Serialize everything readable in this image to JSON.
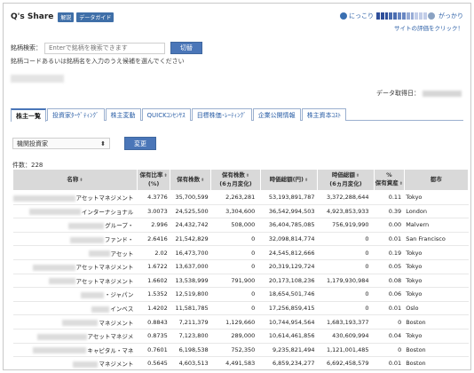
{
  "header": {
    "logo": "Q's Share",
    "badge_explain": "解説",
    "badge_guide": "データガイド"
  },
  "rating": {
    "good_label": "にっこり",
    "bad_label": "がっかり",
    "link": "サイトの評価をクリック！"
  },
  "search": {
    "label": "銘柄検索：",
    "placeholder": "Enterで銘柄を検索できます",
    "button": "切替",
    "hint": "銘柄コードあるいは銘柄名を入力のうえ候補を選んでください"
  },
  "acquisition": {
    "label": "データ取得日："
  },
  "tabs": [
    {
      "label": "株主一覧",
      "active": true
    },
    {
      "label": "投資家ﾀｰｹﾞﾃｨﾝｸﾞ"
    },
    {
      "label": "株主変動"
    },
    {
      "label": "QUICKｺﾝｾﾝｻｽ"
    },
    {
      "label": "目標株価･ﾚｰﾃｨﾝｸﾞ"
    },
    {
      "label": "企業公開情報"
    },
    {
      "label": "株主資本ｺｽﾄ"
    }
  ],
  "filter": {
    "selected": "機関投資家",
    "button": "変更"
  },
  "count": "件数：228",
  "table": {
    "headers": [
      {
        "line1": "名称",
        "line2": ""
      },
      {
        "line1": "保有比率",
        "line2": "(%)"
      },
      {
        "line1": "保有株数",
        "line2": ""
      },
      {
        "line1": "保有株数",
        "line2": "(6ヵ月変化)"
      },
      {
        "line1": "時価総額(円)",
        "line2": ""
      },
      {
        "line1": "時価総額",
        "line2": "(6ヵ月変化)"
      },
      {
        "line1": "%",
        "line2": "保有資産"
      },
      {
        "line1": "都市",
        "line2": ""
      }
    ],
    "rows": [
      {
        "name": "アセットマネジメント",
        "ratio": "4.3776",
        "shares": "35,700,599",
        "shares_ch": "2,263,281",
        "mcap": "53,193,891,787",
        "mcap_ch": "3,372,288,644",
        "pct": "0.11",
        "city": "Tokyo"
      },
      {
        "name": "インターナショナル",
        "ratio": "3.0073",
        "shares": "24,525,500",
        "shares_ch": "3,304,600",
        "mcap": "36,542,994,503",
        "mcap_ch": "4,923,853,933",
        "pct": "0.39",
        "city": "London"
      },
      {
        "name": "グループ・",
        "ratio": "2.996",
        "shares": "24,432,742",
        "shares_ch": "508,000",
        "mcap": "36,404,785,085",
        "mcap_ch": "756,919,990",
        "pct": "0.00",
        "city": "Malvern"
      },
      {
        "name": "ファンド・",
        "ratio": "2.6416",
        "shares": "21,542,829",
        "shares_ch": "0",
        "mcap": "32,098,814,774",
        "mcap_ch": "0",
        "pct": "0.01",
        "city": "San Francisco"
      },
      {
        "name": "アセット",
        "ratio": "2.02",
        "shares": "16,473,700",
        "shares_ch": "0",
        "mcap": "24,545,812,666",
        "mcap_ch": "0",
        "pct": "0.19",
        "city": "Tokyo"
      },
      {
        "name": "アセットマネジメント",
        "ratio": "1.6722",
        "shares": "13,637,000",
        "shares_ch": "0",
        "mcap": "20,319,129,724",
        "mcap_ch": "0",
        "pct": "0.05",
        "city": "Tokyo"
      },
      {
        "name": "アセットマネジメント",
        "ratio": "1.6602",
        "shares": "13,538,999",
        "shares_ch": "791,900",
        "mcap": "20,173,108,236",
        "mcap_ch": "1,179,930,984",
        "pct": "0.08",
        "city": "Tokyo"
      },
      {
        "name": "・ジャパン",
        "ratio": "1.5352",
        "shares": "12,519,800",
        "shares_ch": "0",
        "mcap": "18,654,501,746",
        "mcap_ch": "0",
        "pct": "0.06",
        "city": "Tokyo"
      },
      {
        "name": "インベス",
        "ratio": "1.4202",
        "shares": "11,581,785",
        "shares_ch": "0",
        "mcap": "17,256,859,415",
        "mcap_ch": "0",
        "pct": "0.01",
        "city": "Oslo"
      },
      {
        "name": "マネジメント",
        "ratio": "0.8843",
        "shares": "7,211,379",
        "shares_ch": "1,129,660",
        "mcap": "10,744,954,564",
        "mcap_ch": "1,683,193,377",
        "pct": "0",
        "city": "Boston"
      },
      {
        "name": "アセットマネジメ",
        "ratio": "0.8735",
        "shares": "7,123,800",
        "shares_ch": "289,000",
        "mcap": "10,614,461,856",
        "mcap_ch": "430,609,994",
        "pct": "0.04",
        "city": "Tokyo"
      },
      {
        "name": "キャピタル・マネ",
        "ratio": "0.7601",
        "shares": "6,198,538",
        "shares_ch": "752,350",
        "mcap": "9,235,821,494",
        "mcap_ch": "1,121,001,485",
        "pct": "0",
        "city": "Boston"
      },
      {
        "name": "マネジメント",
        "ratio": "0.5645",
        "shares": "4,603,513",
        "shares_ch": "4,491,583",
        "mcap": "6,859,234,277",
        "mcap_ch": "6,692,458,579",
        "pct": "0.01",
        "city": "Boston"
      }
    ]
  }
}
